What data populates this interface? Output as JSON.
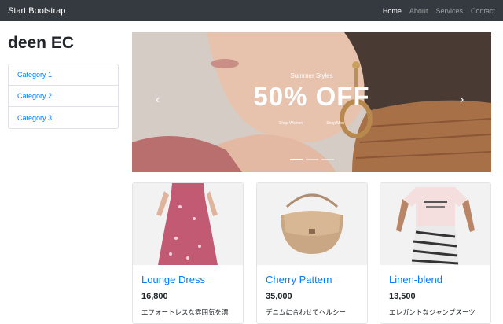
{
  "navbar": {
    "brand": "Start Bootstrap",
    "links": [
      {
        "label": "Home"
      },
      {
        "label": "About"
      },
      {
        "label": "Services"
      },
      {
        "label": "Contact"
      }
    ]
  },
  "sidebar": {
    "title": "deen EC",
    "categories": [
      {
        "label": "Category 1"
      },
      {
        "label": "Category 2"
      },
      {
        "label": "Category 3"
      }
    ]
  },
  "carousel": {
    "subtitle": "Summer Styles",
    "headline": "50% OFF",
    "buttons": [
      "Shop Women",
      "Shop Men"
    ],
    "prev_icon": "‹",
    "next_icon": "›",
    "active_slide": 1,
    "slide_count": 3
  },
  "products": [
    {
      "name": "Lounge Dress",
      "price": "16,800",
      "description": "エフォートレスな雰囲気を漂",
      "image": "floral-dress-image"
    },
    {
      "name": "Cherry Pattern",
      "price": "35,000",
      "description": "デニムに合わせてヘルシー",
      "image": "saddle-bag-image"
    },
    {
      "name": "Linen-blend",
      "price": "13,500",
      "description": "エレガントなジャンプスーツ",
      "image": "tee-zebra-skirt-image"
    }
  ],
  "colors": {
    "navbar_bg": "#343a40",
    "link": "#007bff"
  }
}
